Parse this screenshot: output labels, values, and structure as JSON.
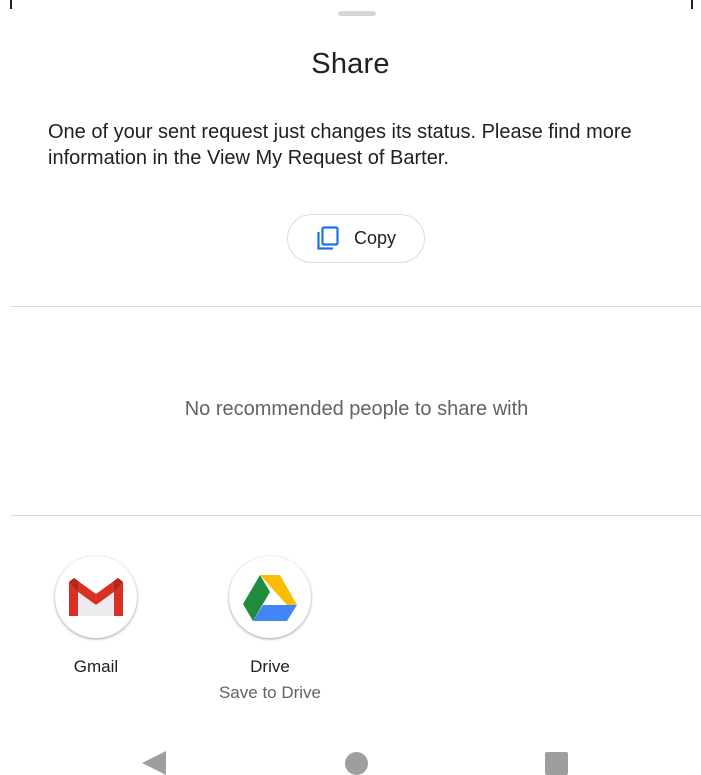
{
  "sheet": {
    "title": "Share",
    "share_text": "One of your sent request just changes its status. Please find more information in the View My Request of Barter.",
    "copy_label": "Copy",
    "empty_people_text": "No recommended people to share with"
  },
  "apps": [
    {
      "label": "Gmail",
      "sublabel": "",
      "icon": "gmail-icon"
    },
    {
      "label": "Drive",
      "sublabel": "Save to Drive",
      "icon": "google-drive-icon"
    }
  ],
  "nav": {
    "back_icon": "back-triangle-icon",
    "home_icon": "home-circle-icon",
    "recents_icon": "recents-square-icon"
  },
  "colors": {
    "accent": "#1a73e8",
    "text_primary": "#202124",
    "text_secondary": "#5f6368",
    "divider": "#dadada",
    "nav_icon": "#9e9e9e"
  }
}
